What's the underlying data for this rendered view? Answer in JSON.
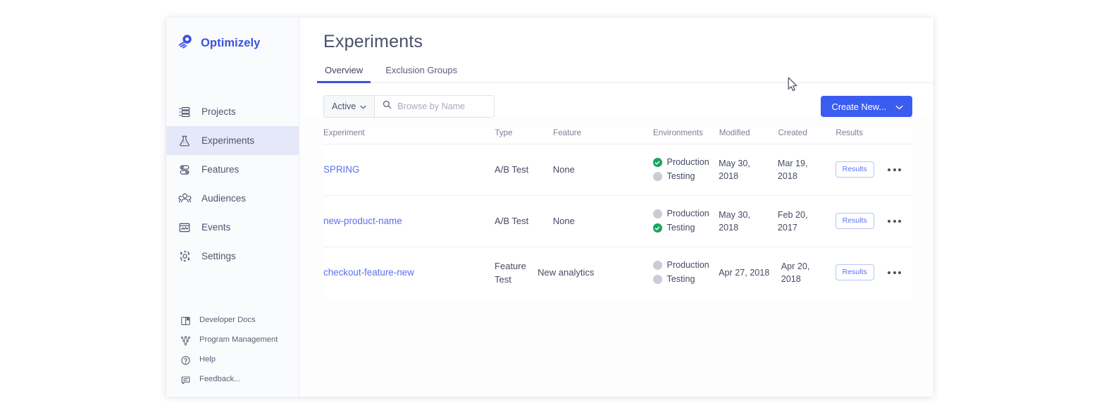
{
  "brand": {
    "name": "Optimizely",
    "logo_icon": "optimizely-comet-logo",
    "color": "#3b52e4"
  },
  "sidebar": {
    "primary_items": [
      {
        "label": "Projects",
        "icon": "projects-list-icon",
        "active": false
      },
      {
        "label": "Experiments",
        "icon": "flask-icon",
        "active": true
      },
      {
        "label": "Features",
        "icon": "toggles-icon",
        "active": false
      },
      {
        "label": "Audiences",
        "icon": "people-icon",
        "active": false
      },
      {
        "label": "Events",
        "icon": "chart-window-icon",
        "active": false
      },
      {
        "label": "Settings",
        "icon": "gear-icon",
        "active": false
      }
    ],
    "secondary_items": [
      {
        "label": "Developer Docs",
        "icon": "book-icon"
      },
      {
        "label": "Program Management",
        "icon": "network-nodes-icon"
      },
      {
        "label": "Help",
        "icon": "question-circle-icon"
      },
      {
        "label": "Feedback...",
        "icon": "speech-bubble-icon"
      }
    ],
    "active_highlight_color": "#e5e8f8"
  },
  "header": {
    "title": "Experiments",
    "tabs": [
      {
        "label": "Overview",
        "active": true
      },
      {
        "label": "Exclusion Groups",
        "active": false
      }
    ],
    "tab_underline_color": "#3b52e4"
  },
  "toolbar": {
    "filter": {
      "value": "Active",
      "chevron_icon": "chevron-down-icon"
    },
    "search": {
      "value": "",
      "placeholder": "Browse by Name",
      "icon": "search-icon"
    },
    "create_button": {
      "label": "Create New...",
      "chevron_icon": "chevron-down-icon",
      "color": "#3b5cf0"
    }
  },
  "table": {
    "columns": [
      "Experiment",
      "Type",
      "Feature",
      "Environments",
      "Modified",
      "Created",
      "Results"
    ],
    "results_button_label": "Results",
    "menu_icon": "kebab-menu-icon",
    "status_on_color": "#19a55c",
    "status_off_color": "#c9ccd6",
    "rows": [
      {
        "experiment": "SPRING",
        "type": "A/B Test",
        "feature": "None",
        "environments": [
          {
            "name": "Production",
            "status": "on"
          },
          {
            "name": "Testing",
            "status": "off"
          }
        ],
        "modified": "May 30, 2018",
        "created": "Mar 19, 2018"
      },
      {
        "experiment": "new-product-name",
        "type": "A/B Test",
        "feature": "None",
        "environments": [
          {
            "name": "Production",
            "status": "off"
          },
          {
            "name": "Testing",
            "status": "on"
          }
        ],
        "modified": "May 30, 2018",
        "created": "Feb 20, 2017"
      },
      {
        "experiment": "checkout-feature-new",
        "type": "Feature Test",
        "feature": "New analytics",
        "environments": [
          {
            "name": "Production",
            "status": "off"
          },
          {
            "name": "Testing",
            "status": "off"
          }
        ],
        "modified": "Apr 27, 2018",
        "created": "Apr 20, 2018"
      }
    ]
  },
  "cursor": {
    "icon": "arrow-cursor"
  }
}
